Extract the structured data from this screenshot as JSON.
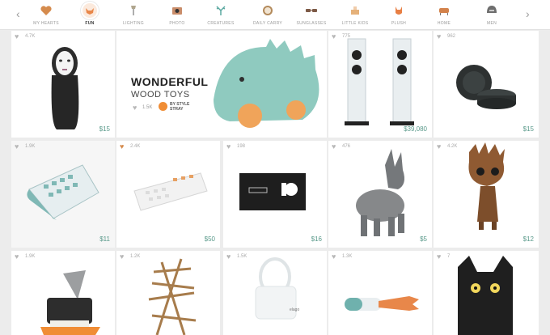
{
  "nav": {
    "prev_arrow": "‹",
    "next_arrow": "›",
    "categories": [
      {
        "label": "MY HEARTS",
        "icon": "heart-icon",
        "color": "#d58b4d",
        "active": false
      },
      {
        "label": "FUN",
        "icon": "fox-icon",
        "color": "#e8874a",
        "active": true
      },
      {
        "label": "LIGHTING",
        "icon": "lamp-icon",
        "color": "#b0a68e",
        "active": false
      },
      {
        "label": "PHOTO",
        "icon": "camera-icon",
        "color": "#c98d6a",
        "active": false
      },
      {
        "label": "CREATURES",
        "icon": "antler-icon",
        "color": "#5aa8a0",
        "active": false
      },
      {
        "label": "DAILY CARRY",
        "icon": "watch-icon",
        "color": "#b38a5b",
        "active": false
      },
      {
        "label": "SUNGLASSES",
        "icon": "sunglasses-icon",
        "color": "#7d5a47",
        "active": false
      },
      {
        "label": "LITTLE KIDS",
        "icon": "toy-icon",
        "color": "#e5b17a",
        "active": false
      },
      {
        "label": "PLUSH",
        "icon": "plush-fox-icon",
        "color": "#e87f44",
        "active": false
      },
      {
        "label": "HOME",
        "icon": "chair-icon",
        "color": "#d3824b",
        "active": false
      },
      {
        "label": "MEN",
        "icon": "helmet-icon",
        "color": "#6e6e6e",
        "active": false
      }
    ]
  },
  "featured": {
    "title_line1": "WONDERFUL",
    "title_line2": "WOOD TOYS",
    "hearts": "1.5K",
    "brand": "BY STYLE STRAY"
  },
  "products": [
    {
      "id": "no-face",
      "hearts": "4.7K",
      "price": "$15",
      "hearted": false
    },
    {
      "id": "speakers",
      "hearts": "775",
      "price": "$39,080",
      "hearted": false
    },
    {
      "id": "puck",
      "hearts": "962",
      "price": "$15",
      "hearted": false
    },
    {
      "id": "flex-keyboard",
      "hearts": "1.9K",
      "price": "$11",
      "hearted": false
    },
    {
      "id": "mech-keyboard",
      "hearts": "2.4K",
      "price": "$50",
      "hearted": true
    },
    {
      "id": "card-box",
      "hearts": "198",
      "price": "$16",
      "hearted": false
    },
    {
      "id": "donkey",
      "hearts": "476",
      "price": "$5",
      "hearted": false
    },
    {
      "id": "groot",
      "hearts": "4.2K",
      "price": "$12",
      "hearted": false
    },
    {
      "id": "shark-timer",
      "hearts": "1.9K",
      "price": "",
      "hearted": false
    },
    {
      "id": "wood-stack",
      "hearts": "1.2K",
      "price": "",
      "hearted": false
    },
    {
      "id": "cable-tool",
      "hearts": "1.5K",
      "price": "",
      "hearted": false
    },
    {
      "id": "fish-pill",
      "hearts": "1.3K",
      "price": "",
      "hearted": false
    },
    {
      "id": "black-cat",
      "hearts": "7",
      "price": "",
      "hearted": false
    }
  ],
  "cable_tool_label": "elago"
}
